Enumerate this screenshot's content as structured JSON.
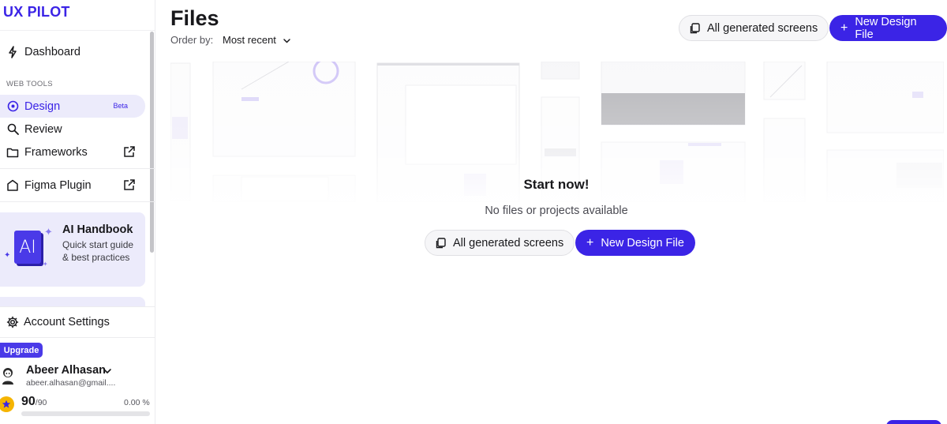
{
  "brand": {
    "logo_text": "UX PILOT",
    "accent": "#3b24e6"
  },
  "sidebar": {
    "dashboard_label": "Dashboard",
    "section_label": "WEB TOOLS",
    "items": [
      {
        "label": "Design",
        "badge": "Beta",
        "active": true
      },
      {
        "label": "Review"
      },
      {
        "label": "Frameworks"
      }
    ],
    "figma_plugin_label": "Figma Plugin",
    "handbook": {
      "title": "AI Handbook",
      "description": "Quick start guide & best practices",
      "book_text": "AI"
    },
    "account_settings_label": "Account Settings",
    "upgrade_label": "Upgrade",
    "user": {
      "name": "Abeer Alhasan",
      "email": "abeer.alhasan@gmail...."
    },
    "credits": {
      "value": "90",
      "total": "/90",
      "percent_text": "0.00 %",
      "progress": 0.0
    }
  },
  "main": {
    "title": "Files",
    "order_label": "Order by:",
    "order_value": "Most recent",
    "all_generated_label": "All generated screens",
    "new_design_label": "New Design File",
    "empty_title": "Start now!",
    "empty_message": "No files or projects available"
  }
}
